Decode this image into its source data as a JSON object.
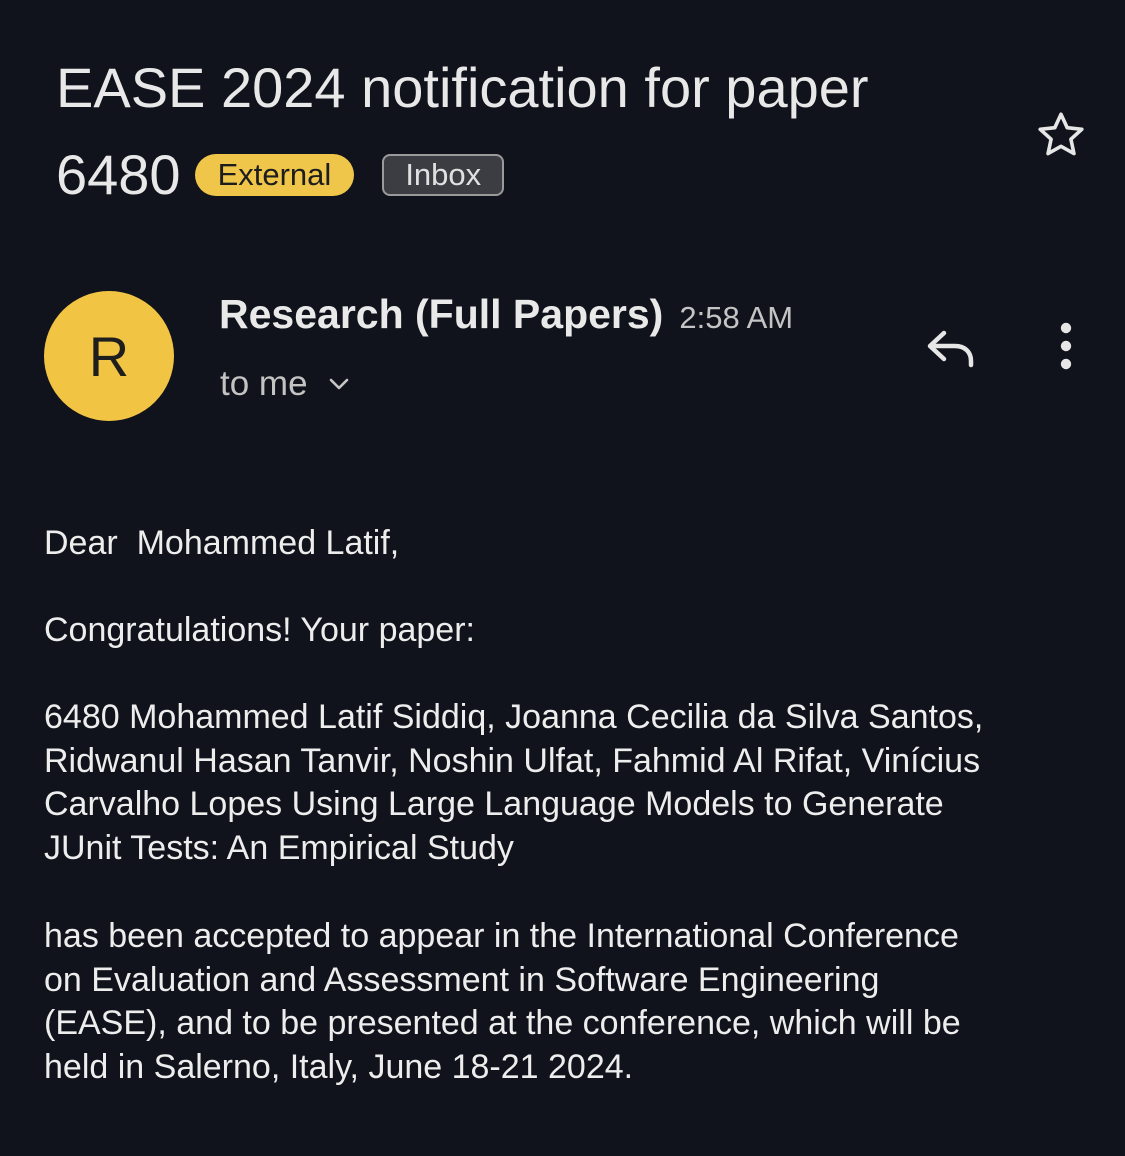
{
  "email": {
    "subject_line1": "EASE 2024 notification for paper",
    "subject_line2": "6480",
    "labels": {
      "external": "External",
      "inbox": "Inbox"
    },
    "sender": {
      "avatar_letter": "R",
      "name": "Research (Full Papers)",
      "time": "2:58 AM",
      "recipient": "to me"
    },
    "body": {
      "greeting": "Dear  Mohammed Latif,",
      "congrats": "Congratulations! Your paper:",
      "paper_line1": "6480 Mohammed Latif Siddiq, Joanna Cecilia da Silva Santos,",
      "paper_line2": "Ridwanul Hasan Tanvir, Noshin Ulfat, Fahmid Al Rifat, Vinícius",
      "paper_line3": "Carvalho Lopes Using Large Language Models to Generate",
      "paper_line4": "JUnit Tests: An Empirical Study",
      "accept_line1": "has been accepted to appear in the International Conference",
      "accept_line2": "on Evaluation and Assessment in Software Engineering",
      "accept_line3": "(EASE), and to be presented at the conference, which will be",
      "accept_line4": "held in Salerno, Italy, June 18-21 2024."
    }
  },
  "colors": {
    "background": "#10131b",
    "avatar": "#f2c444",
    "external_chip": "#f0c64a",
    "text": "#e8e8e8"
  },
  "icons": {
    "star": "star-icon",
    "reply": "reply-icon",
    "more": "more-vert-icon",
    "expand": "chevron-down-icon"
  }
}
